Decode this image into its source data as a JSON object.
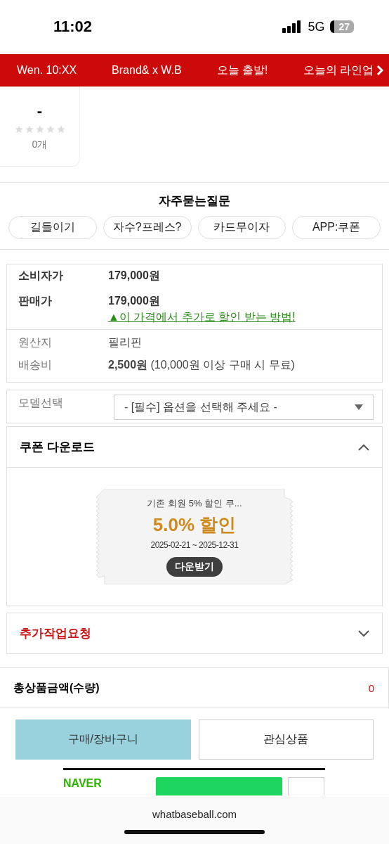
{
  "status_bar": {
    "time": "11:02",
    "network": "5G",
    "battery": "27"
  },
  "top_nav": {
    "items": [
      "Wen. 10:XX",
      "Brand& x W.B",
      "오늘 출발!",
      "오늘의 라인업"
    ]
  },
  "review": {
    "score": "-",
    "stars": 0,
    "count": "0개"
  },
  "faq": {
    "title": "자주묻는질문",
    "buttons": [
      "길들이기",
      "자수?프레스?",
      "카드무이자",
      "APP:쿠폰"
    ]
  },
  "info": [
    {
      "kind": "price",
      "label": "소비자가",
      "value": "179,000원"
    },
    {
      "kind": "price",
      "label": "판매가",
      "value": "179,000원",
      "link": "▲이 가격에서 추가로 할인 받는 방법!"
    },
    {
      "kind": "plain",
      "label": "원산지",
      "value": "필리핀"
    },
    {
      "kind": "plain",
      "label": "배송비",
      "value": "**2,500원** (10,000원 이상 구매 시 무료)"
    }
  ],
  "option": {
    "label": "모델선택",
    "placeholder": "- [필수] 옵션을 선택해 주세요 -"
  },
  "coupon_panel": {
    "title": "쿠폰 다운로드",
    "expanded": true,
    "coupon": {
      "name": "기존 회원 5% 할인 쿠...",
      "discount": "5.0% 할인",
      "period": "2025-02-21 ~ 2025-12-31",
      "button": "다운받기"
    }
  },
  "extra_panel": {
    "title": "추가작업요청",
    "expanded": false
  },
  "total": {
    "label": "총상품금액(수량)",
    "value": "0"
  },
  "actions": [
    {
      "kind": "primary",
      "label": "구매/장바구니"
    },
    {
      "kind": "secondary",
      "label": "관심상품"
    }
  ],
  "naver": {
    "brand": "NAVER"
  },
  "browser": {
    "url": "whatbaseball.com"
  }
}
